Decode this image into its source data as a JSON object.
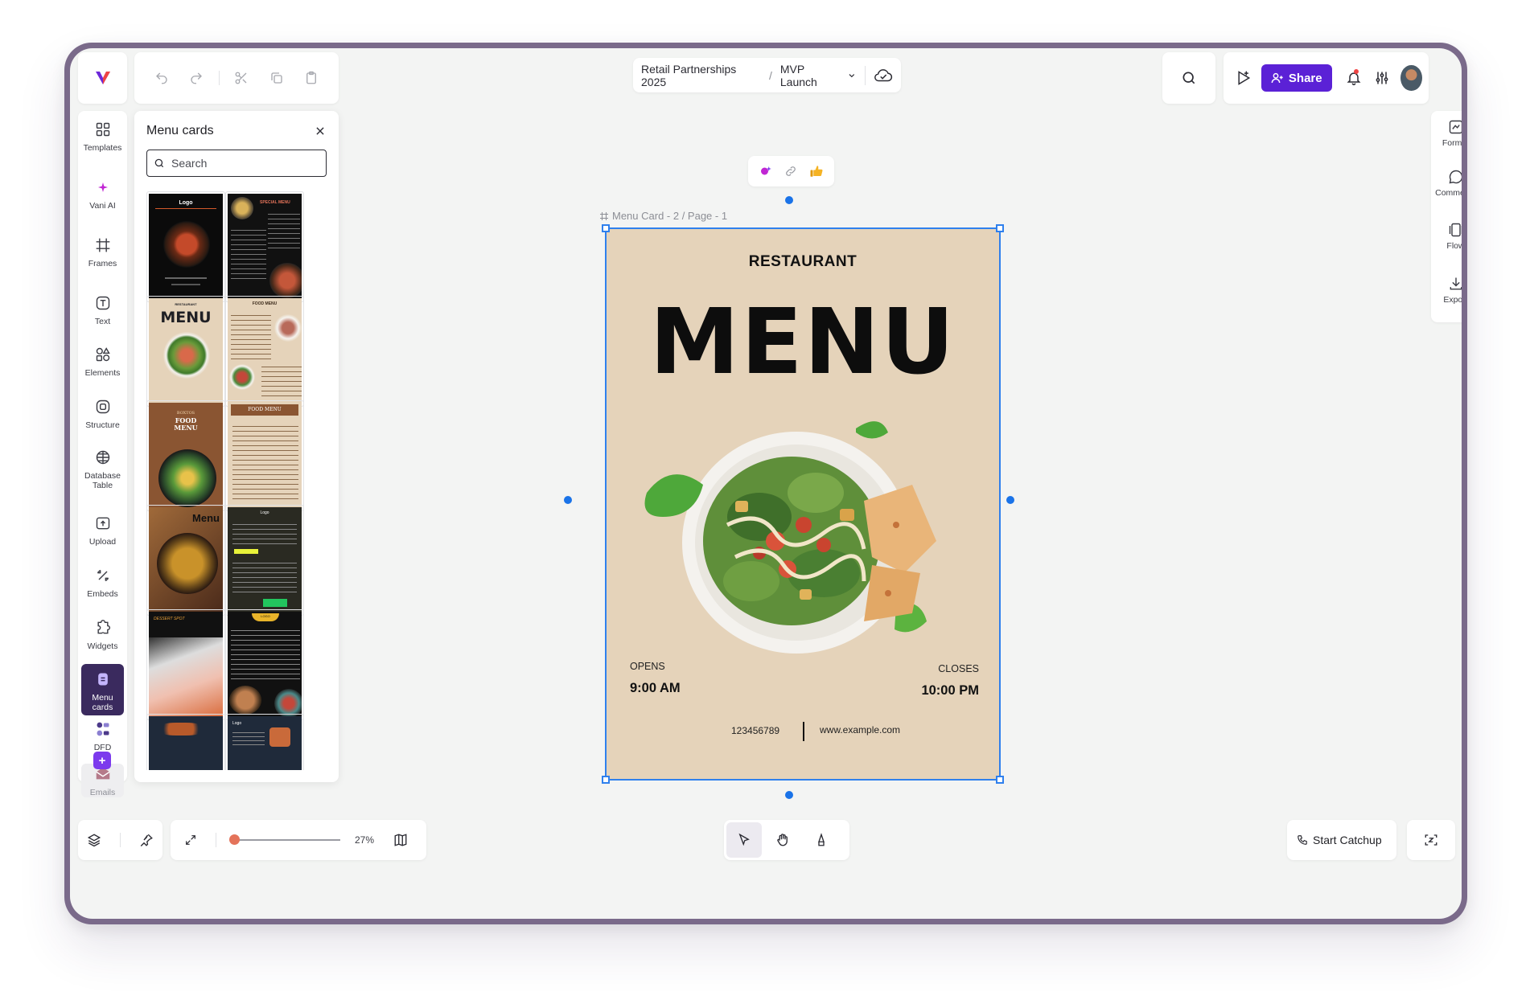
{
  "breadcrumb": {
    "workspace": "Retail Partnerships 2025",
    "page": "MVP Launch"
  },
  "header": {
    "share_label": "Share"
  },
  "sidebar": {
    "items": [
      {
        "label": "Templates",
        "icon": "grid-icon"
      },
      {
        "label": "Vani AI",
        "icon": "sparkle-icon"
      },
      {
        "label": "Frames",
        "icon": "frame-icon"
      },
      {
        "label": "Text",
        "icon": "text-icon"
      },
      {
        "label": "Elements",
        "icon": "shapes-icon"
      },
      {
        "label": "Structure",
        "icon": "structure-icon"
      },
      {
        "label": "Database Table",
        "icon": "table-icon"
      },
      {
        "label": "Upload",
        "icon": "upload-icon"
      },
      {
        "label": "Embeds",
        "icon": "embed-icon"
      },
      {
        "label": "Widgets",
        "icon": "widget-icon"
      },
      {
        "label": "Menu cards",
        "icon": "menu-card-icon",
        "active": true
      },
      {
        "label": "DFD",
        "icon": "dfd-icon"
      },
      {
        "label": "Emails",
        "icon": "email-icon"
      }
    ]
  },
  "panel": {
    "title": "Menu cards",
    "search_placeholder": "Search",
    "thumbnails": [
      {
        "caption": "Logo"
      },
      {
        "caption": "SPECIAL MENU"
      },
      {
        "caption": "MENU",
        "subtitle": "RESTAURANT"
      },
      {
        "caption": "FOOD MENU"
      },
      {
        "caption": "FOOD MENU",
        "subtitle": "BOXTOS"
      },
      {
        "caption": "FOOD MENU"
      },
      {
        "caption": "Menu"
      },
      {
        "caption": "Logo"
      },
      {
        "caption": "DESSERT SPOT"
      },
      {
        "caption": "LOGO"
      },
      {
        "caption": ""
      },
      {
        "caption": "Logo"
      }
    ]
  },
  "canvas": {
    "frame_label": "Menu Card - 2 / Page - 1",
    "menu": {
      "restaurant": "RESTAURANT",
      "title": "MENU",
      "opens_label": "OPENS",
      "opens_time": "9:00 AM",
      "closes_label": "CLOSES",
      "closes_time": "10:00 PM",
      "phone": "123456789",
      "website": "www.example.com"
    }
  },
  "right_panel": {
    "items": [
      {
        "label": "Format",
        "icon": "format-icon"
      },
      {
        "label": "Comments",
        "icon": "comment-icon"
      },
      {
        "label": "Flow",
        "icon": "flow-icon"
      },
      {
        "label": "Export",
        "icon": "export-icon"
      }
    ]
  },
  "bottom": {
    "zoom_value": "27%",
    "zoom_fraction": 0.0,
    "catchup_label": "Start Catchup"
  },
  "colors": {
    "accent": "#5b21d6",
    "selection": "#2f80ed",
    "menu_bg": "#e5d3ba",
    "active_sidebar": "#3a2a5e"
  }
}
